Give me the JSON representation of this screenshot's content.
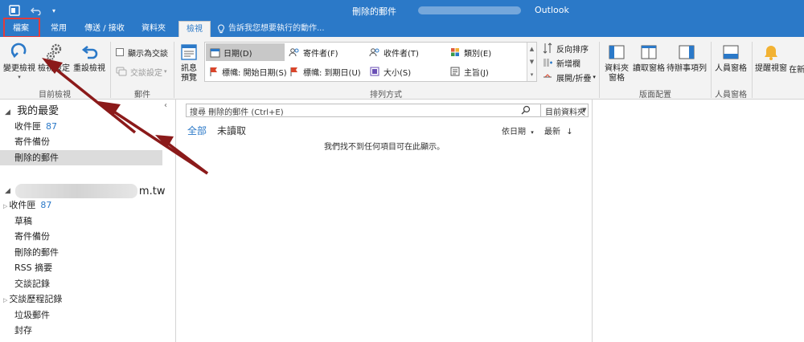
{
  "window": {
    "title": "刪除的郵件",
    "app_name": "Outlook"
  },
  "tabs": [
    {
      "label": "檔案"
    },
    {
      "label": "常用"
    },
    {
      "label": "傳送 / 接收"
    },
    {
      "label": "資料夾"
    },
    {
      "label": "檢視"
    }
  ],
  "tell_me": "告訴我您想要執行的動作...",
  "ribbon": {
    "current_view": {
      "change_view": "變更檢視",
      "view_settings": "檢視設定",
      "reset_view": "重設檢視",
      "group_label": "目前檢視"
    },
    "messages": {
      "show_as_conversations": "顯示為交談",
      "conversation_settings": "交談設定",
      "group_label": "郵件"
    },
    "arrangement": {
      "message_preview": "訊息預覽",
      "gallery": [
        {
          "label": "日期(D)",
          "selected": true,
          "icon": "calendar-icon"
        },
        {
          "label": "寄件者(F)",
          "selected": false,
          "icon": "people-icon"
        },
        {
          "label": "收件者(T)",
          "selected": false,
          "icon": "people-icon"
        },
        {
          "label": "類別(E)",
          "selected": false,
          "icon": "category-icon"
        },
        {
          "label": "標幟: 開始日期(S)",
          "selected": false,
          "icon": "flag-icon"
        },
        {
          "label": "標幟: 到期日(U)",
          "selected": false,
          "icon": "flag-icon"
        },
        {
          "label": "大小(S)",
          "selected": false,
          "icon": "size-icon"
        },
        {
          "label": "主旨(J)",
          "selected": false,
          "icon": "subject-icon"
        }
      ],
      "reverse_sort": "反向排序",
      "add_columns": "新增欄",
      "expand_collapse": "展開/折疊",
      "group_label": "排列方式"
    },
    "layout": {
      "folder_pane": "資料夾窗格",
      "reading_pane": "讀取窗格",
      "todo_bar": "待辦事項列",
      "group_label": "版面配置"
    },
    "people_pane": {
      "label": "人員窗格",
      "group_label": "人員窗格"
    },
    "window": {
      "reminders_window": "提醒視窗",
      "open_in_new_window": "在新"
    }
  },
  "folder_pane": {
    "favorites_title": "我的最愛",
    "favorites": [
      {
        "label": "收件匣",
        "count": "87"
      },
      {
        "label": "寄件備份",
        "count": ""
      },
      {
        "label": "刪除的郵件",
        "count": "",
        "selected": true
      }
    ],
    "account_suffix": "m.tw",
    "account_folders": [
      {
        "label": "收件匣",
        "count": "87",
        "expandable": true
      },
      {
        "label": "草稿",
        "count": ""
      },
      {
        "label": "寄件備份",
        "count": ""
      },
      {
        "label": "刪除的郵件",
        "count": ""
      },
      {
        "label": "RSS 摘要",
        "count": ""
      },
      {
        "label": "交談記錄",
        "count": ""
      },
      {
        "label": "交談歷程記錄",
        "count": "",
        "expandable": true
      },
      {
        "label": "垃圾郵件",
        "count": ""
      },
      {
        "label": "封存",
        "count": ""
      }
    ]
  },
  "message_list": {
    "search_placeholder": "搜尋 刪除的郵件 (Ctrl+E)",
    "search_scope": "目前資料夾",
    "filter_all": "全部",
    "filter_unread": "未讀取",
    "sort_by": "依日期",
    "sort_order": "最新",
    "empty_message": "我們找不到任何項目可在此顯示。"
  },
  "colors": {
    "accent": "#2b79c8",
    "annotation_red": "#e23b3b",
    "arrow": "#8b1a1a"
  }
}
